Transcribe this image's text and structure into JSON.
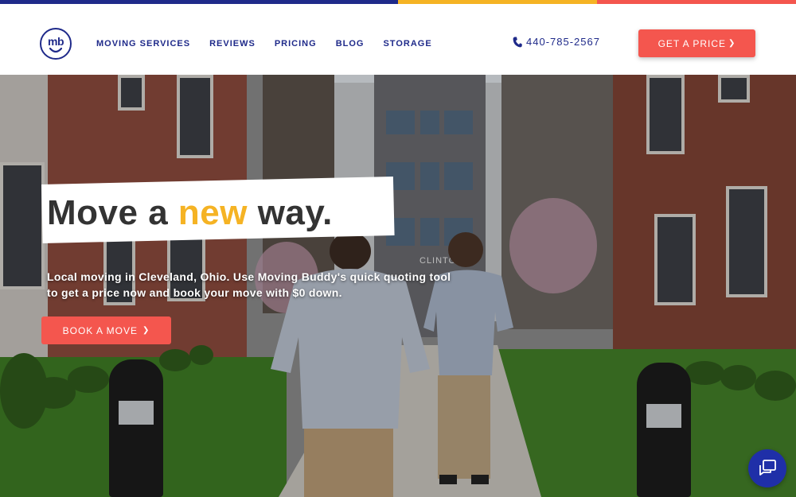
{
  "stripe_colors": [
    "#1f2a8a",
    "#f5b324",
    "#f4564e"
  ],
  "logo": {
    "text": "mb"
  },
  "nav": {
    "items": [
      {
        "label": "MOVING SERVICES"
      },
      {
        "label": "REVIEWS"
      },
      {
        "label": "PRICING"
      },
      {
        "label": "BLOG"
      },
      {
        "label": "STORAGE"
      }
    ]
  },
  "contact": {
    "phone": "440-785-2567",
    "icon": "phone-icon"
  },
  "header_cta": {
    "label": "GET A PRICE",
    "arrow": "❯"
  },
  "hero": {
    "headline_pre": "Move a ",
    "headline_highlight": "new",
    "headline_post": " way.",
    "subtext": "Local moving in Cleveland, Ohio. Use Moving Buddy's quick quoting tool to get a price now and book your move with $0 down.",
    "cta_label": "BOOK A MOVE",
    "cta_arrow": "❯",
    "sign_text": "CLINTON"
  },
  "chat_widget": {
    "icon": "chat-bubble-icon"
  },
  "colors": {
    "brand_navy": "#1f2a8a",
    "accent_yellow": "#f5b324",
    "accent_coral": "#f4564e",
    "chat_blue": "#1f2fa8"
  }
}
